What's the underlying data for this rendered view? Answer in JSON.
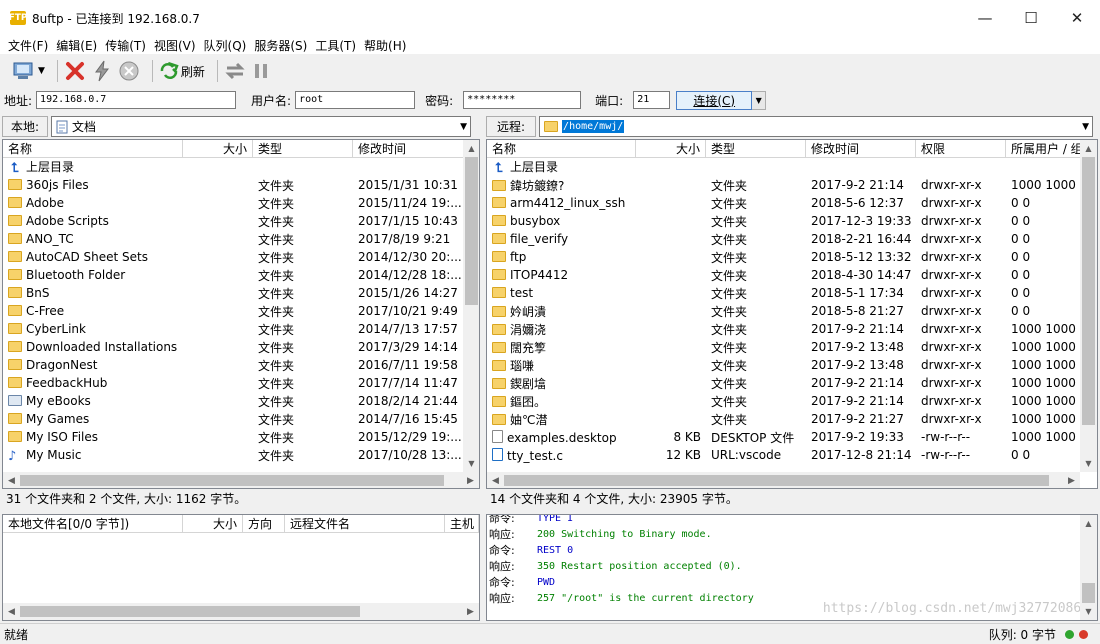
{
  "window": {
    "title": "8uftp - 已连接到 192.168.0.7",
    "app_icon_text": "FTP",
    "minimize": "—",
    "maximize": "☐",
    "close": "✕"
  },
  "menu": [
    "文件(F)",
    "编辑(E)",
    "传输(T)",
    "视图(V)",
    "队列(Q)",
    "服务器(S)",
    "工具(T)",
    "帮助(H)"
  ],
  "toolbar": {
    "refresh_label": "刷新"
  },
  "connection": {
    "address_label": "地址:",
    "address": "192.168.0.7",
    "user_label": "用户名:",
    "user": "root",
    "password_label": "密码:",
    "password": "********",
    "port_label": "端口:",
    "port": "21",
    "connect_label": "连接(C)"
  },
  "local": {
    "path_label": "本地:",
    "path": "文档",
    "columns": [
      "名称",
      "大小",
      "类型",
      "修改时间"
    ],
    "parent_label": "上层目录",
    "items": [
      {
        "name": "360js Files",
        "type": "文件夹",
        "modified": "2015/1/31 10:31",
        "icon": "folder"
      },
      {
        "name": "Adobe",
        "type": "文件夹",
        "modified": "2015/11/24 19:...",
        "icon": "folder"
      },
      {
        "name": "Adobe Scripts",
        "type": "文件夹",
        "modified": "2017/1/15 10:43",
        "icon": "folder"
      },
      {
        "name": "ANO_TC",
        "type": "文件夹",
        "modified": "2017/8/19 9:21",
        "icon": "folder"
      },
      {
        "name": "AutoCAD Sheet Sets",
        "type": "文件夹",
        "modified": "2014/12/30 20:...",
        "icon": "folder"
      },
      {
        "name": "Bluetooth Folder",
        "type": "文件夹",
        "modified": "2014/12/28 18:...",
        "icon": "folder"
      },
      {
        "name": "BnS",
        "type": "文件夹",
        "modified": "2015/1/26 14:27",
        "icon": "folder"
      },
      {
        "name": "C-Free",
        "type": "文件夹",
        "modified": "2017/10/21 9:49",
        "icon": "folder"
      },
      {
        "name": "CyberLink",
        "type": "文件夹",
        "modified": "2014/7/13 17:57",
        "icon": "folder"
      },
      {
        "name": "Downloaded Installations",
        "type": "文件夹",
        "modified": "2017/3/29 14:14",
        "icon": "folder"
      },
      {
        "name": "DragonNest",
        "type": "文件夹",
        "modified": "2016/7/11 19:58",
        "icon": "folder"
      },
      {
        "name": "FeedbackHub",
        "type": "文件夹",
        "modified": "2017/7/14 11:47",
        "icon": "folder"
      },
      {
        "name": "My eBooks",
        "type": "文件夹",
        "modified": "2018/2/14 21:44",
        "icon": "ebook"
      },
      {
        "name": "My Games",
        "type": "文件夹",
        "modified": "2014/7/16 15:45",
        "icon": "folder"
      },
      {
        "name": "My ISO Files",
        "type": "文件夹",
        "modified": "2015/12/29 19:...",
        "icon": "folder"
      },
      {
        "name": "My Music",
        "type": "文件夹",
        "modified": "2017/10/28 13:...",
        "icon": "music"
      }
    ],
    "status": "31 个文件夹和 2 个文件, 大小: 1162 字节。"
  },
  "remote": {
    "path_label": "远程:",
    "path": "/home/mwj/",
    "columns": [
      "名称",
      "大小",
      "类型",
      "修改时间",
      "权限",
      "所属用户 / 组"
    ],
    "parent_label": "上层目录",
    "items": [
      {
        "name": "鍏坊鍍鐐?",
        "size": "",
        "type": "文件夹",
        "modified": "2017-9-2 21:14",
        "perm": "drwxr-xr-x",
        "owner": "1000 1000",
        "icon": "folder"
      },
      {
        "name": "arm4412_linux_ssh",
        "size": "",
        "type": "文件夹",
        "modified": "2018-5-6 12:37",
        "perm": "drwxr-xr-x",
        "owner": "0 0",
        "icon": "folder"
      },
      {
        "name": "busybox",
        "size": "",
        "type": "文件夹",
        "modified": "2017-12-3 19:33",
        "perm": "drwxr-xr-x",
        "owner": "0 0",
        "icon": "folder"
      },
      {
        "name": "file_verify",
        "size": "",
        "type": "文件夹",
        "modified": "2018-2-21 16:44",
        "perm": "drwxr-xr-x",
        "owner": "0 0",
        "icon": "folder"
      },
      {
        "name": "ftp",
        "size": "",
        "type": "文件夹",
        "modified": "2018-5-12 13:32",
        "perm": "drwxr-xr-x",
        "owner": "0 0",
        "icon": "folder"
      },
      {
        "name": "ITOP4412",
        "size": "",
        "type": "文件夹",
        "modified": "2018-4-30 14:47",
        "perm": "drwxr-xr-x",
        "owner": "0 0",
        "icon": "folder"
      },
      {
        "name": "test",
        "size": "",
        "type": "文件夹",
        "modified": "2018-5-1 17:34",
        "perm": "drwxr-xr-x",
        "owner": "0 0",
        "icon": "folder"
      },
      {
        "name": "妗岄潰",
        "size": "",
        "type": "文件夹",
        "modified": "2018-5-8 21:27",
        "perm": "drwxr-xr-x",
        "owner": "0 0",
        "icon": "folder"
      },
      {
        "name": "涓嬭浇",
        "size": "",
        "type": "文件夹",
        "modified": "2017-9-2 21:14",
        "perm": "drwxr-xr-x",
        "owner": "1000 1000",
        "icon": "folder"
      },
      {
        "name": "闊充箰",
        "size": "",
        "type": "文件夹",
        "modified": "2017-9-2 13:48",
        "perm": "drwxr-xr-x",
        "owner": "1000 1000",
        "icon": "folder"
      },
      {
        "name": "瑙嗛",
        "size": "",
        "type": "文件夹",
        "modified": "2017-9-2 13:48",
        "perm": "drwxr-xr-x",
        "owner": "1000 1000",
        "icon": "folder"
      },
      {
        "name": "鍥剧墖",
        "size": "",
        "type": "文件夹",
        "modified": "2017-9-2 21:14",
        "perm": "drwxr-xr-x",
        "owner": "1000 1000",
        "icon": "folder"
      },
      {
        "name": "鏂囨。",
        "size": "",
        "type": "文件夹",
        "modified": "2017-9-2 21:14",
        "perm": "drwxr-xr-x",
        "owner": "1000 1000",
        "icon": "folder"
      },
      {
        "name": "妯℃澘",
        "size": "",
        "type": "文件夹",
        "modified": "2017-9-2 21:27",
        "perm": "drwxr-xr-x",
        "owner": "1000 1000",
        "icon": "folder"
      },
      {
        "name": "examples.desktop",
        "size": "8 KB",
        "type": "DESKTOP 文件",
        "modified": "2017-9-2 19:33",
        "perm": "-rw-r--r--",
        "owner": "1000 1000",
        "icon": "file"
      },
      {
        "name": "tty_test.c",
        "size": "12 KB",
        "type": "URL:vscode",
        "modified": "2017-12-8 21:14",
        "perm": "-rw-r--r--",
        "owner": "0 0",
        "icon": "code"
      }
    ],
    "status": "14 个文件夹和 4 个文件, 大小: 23905 字节。"
  },
  "queue": {
    "columns": [
      "本地文件名[0/0 字节])",
      "大小",
      "方向",
      "远程文件名",
      "主机"
    ]
  },
  "log": [
    {
      "kind": "命令:",
      "text": "TYPE I",
      "type": "cmd"
    },
    {
      "kind": "响应:",
      "text": "200 Switching to Binary mode.",
      "type": "resp"
    },
    {
      "kind": "命令:",
      "text": "REST 0",
      "type": "cmd"
    },
    {
      "kind": "响应:",
      "text": "350 Restart position accepted (0).",
      "type": "resp"
    },
    {
      "kind": "命令:",
      "text": "PWD",
      "type": "cmd"
    },
    {
      "kind": "响应:",
      "text": "257 \"/root\" is the current directory",
      "type": "resp"
    }
  ],
  "watermark": "https://blog.csdn.net/mwj327720862",
  "statusbar": {
    "ready": "就绪",
    "queue": "队列: 0 字节"
  },
  "colors": {
    "accent": "#0078d7",
    "command": "#0000c8",
    "response": "#008000",
    "folder": "#f7d26a"
  }
}
